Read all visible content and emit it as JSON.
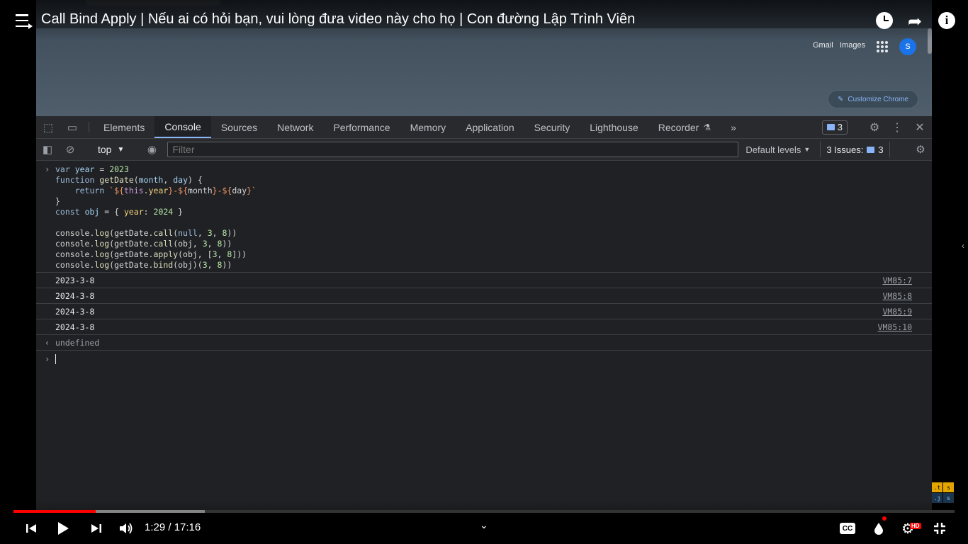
{
  "youtube": {
    "title": "Call Bind Apply | Nếu ai có hỏi bạn, vui lòng đưa video này cho họ | Con đường Lập Trình Viên",
    "time": "1:29 / 17:16",
    "progress_played": 0.087,
    "progress_buffered": 0.203,
    "cc_label": "CC",
    "hd_label": "HD"
  },
  "ntp": {
    "gmail": "Gmail",
    "images": "Images",
    "avatar": "S",
    "customize": "Customize Chrome"
  },
  "devtools": {
    "tabs": [
      "Elements",
      "Console",
      "Sources",
      "Network",
      "Performance",
      "Memory",
      "Application",
      "Security",
      "Lighthouse",
      "Recorder"
    ],
    "messages_count": "3",
    "context": "top",
    "filter_placeholder": "Filter",
    "levels": "Default levels",
    "issues": "3 Issues:",
    "issues_count": "3"
  },
  "console": {
    "outputs": [
      {
        "value": "2023-3-8",
        "source": "VM85:7"
      },
      {
        "value": "2024-3-8",
        "source": "VM85:8"
      },
      {
        "value": "2024-3-8",
        "source": "VM85:9"
      },
      {
        "value": "2024-3-8",
        "source": "VM85:10"
      }
    ],
    "result": "undefined"
  },
  "brand": [
    ".t",
    "s",
    ".j",
    "s"
  ],
  "colors": {
    "accent": "#8ab4f8",
    "progress": "#ff0000",
    "devtools_bg": "#202124"
  }
}
